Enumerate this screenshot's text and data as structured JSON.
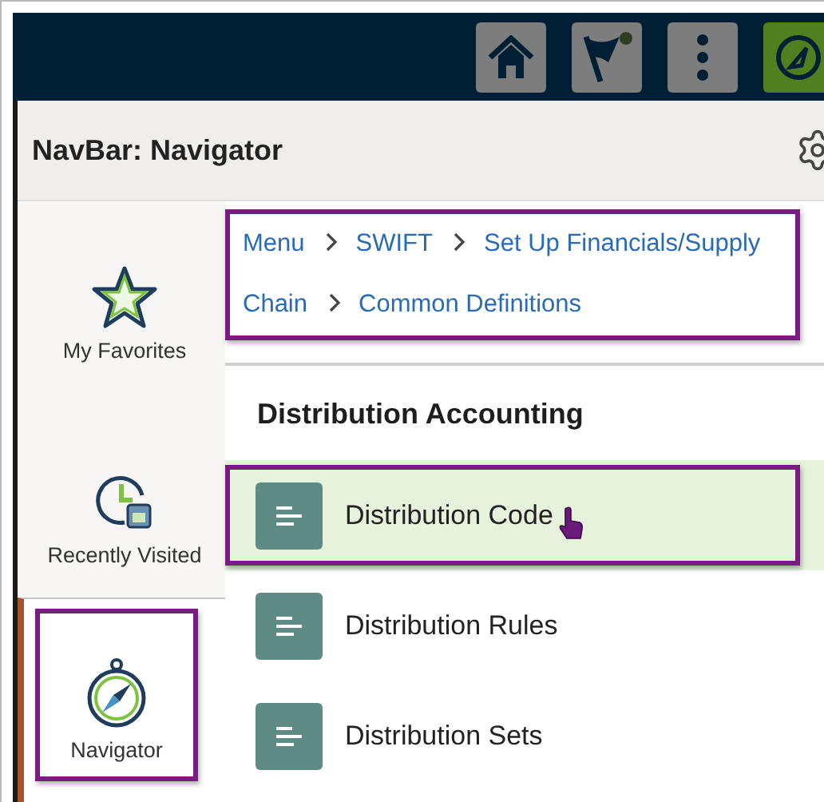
{
  "top_bar": {
    "buttons": [
      {
        "kind": "home",
        "selected": false
      },
      {
        "kind": "flag",
        "selected": false
      },
      {
        "kind": "more",
        "selected": false
      },
      {
        "kind": "navigator",
        "selected": true
      }
    ]
  },
  "panel": {
    "title": "NavBar: Navigator"
  },
  "sidebar": {
    "items": [
      {
        "label": "My Favorites",
        "kind": "favorites",
        "selected": false,
        "highlighted": false
      },
      {
        "label": "Recently Visited",
        "kind": "recent",
        "selected": false,
        "highlighted": false
      },
      {
        "label": "Navigator",
        "kind": "navigator",
        "selected": true,
        "highlighted": true
      }
    ]
  },
  "breadcrumb": {
    "highlighted": true,
    "items": [
      {
        "label": "Menu",
        "kind": "link"
      },
      {
        "label": "SWIFT",
        "kind": "link"
      },
      {
        "label": "Set Up Financials/Supply Chain",
        "kind": "wrapped_link"
      },
      {
        "label": "Common Definitions",
        "kind": "link"
      }
    ]
  },
  "folder": {
    "title": "Distribution Accounting",
    "items": [
      {
        "label": "Distribution Code",
        "selected": true,
        "highlighted": true,
        "hovered": true
      },
      {
        "label": "Distribution Rules",
        "selected": false,
        "highlighted": false,
        "hovered": false
      },
      {
        "label": "Distribution Sets",
        "selected": false,
        "highlighted": false,
        "hovered": false
      }
    ]
  }
}
